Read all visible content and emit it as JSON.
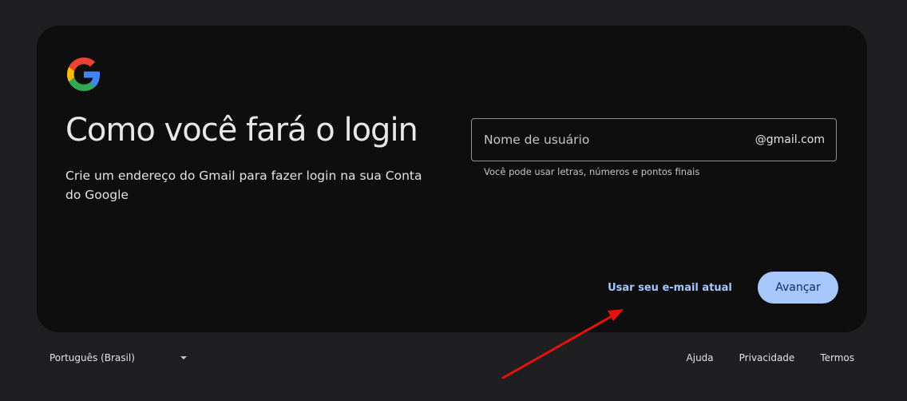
{
  "heading": "Como você fará o login",
  "subtitle": "Crie um endereço do Gmail para fazer login na sua Conta do Google",
  "username_field": {
    "placeholder": "Nome de usuário",
    "value": "",
    "suffix": "@gmail.com",
    "hint": "Você pode usar letras, números e pontos finais"
  },
  "actions": {
    "use_existing_email": "Usar seu e-mail atual",
    "next": "Avançar"
  },
  "footer": {
    "language": "Português (Brasil)",
    "links": {
      "help": "Ajuda",
      "privacy": "Privacidade",
      "terms": "Termos"
    }
  },
  "colors": {
    "background": "#1f1f21",
    "card": "#0e0e0e",
    "accent": "#a8c7fa",
    "annotation_arrow": "#e8120c"
  },
  "icons": {
    "logo": "google-g-logo",
    "language_caret": "caret-down-icon",
    "annotation": "red-arrow-annotation"
  }
}
